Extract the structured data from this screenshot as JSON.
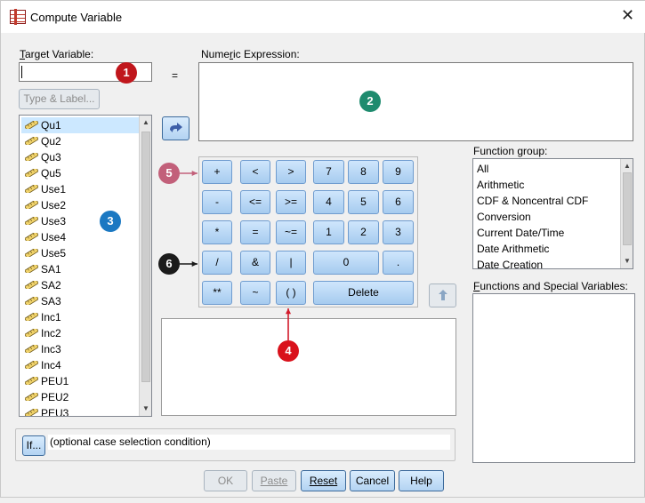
{
  "window": {
    "title": "Compute Variable",
    "close_glyph": "✕"
  },
  "target_variable": {
    "label_prefix": "",
    "label_underline": "T",
    "label_rest": "arget Variable:",
    "value": ""
  },
  "equals_sign": "=",
  "numeric_expression": {
    "label_pre": "Nume",
    "label_underline": "r",
    "label_post": "ic Expression:",
    "value": ""
  },
  "type_label_button": "Type & Label...",
  "move_button_icon": "arrow-right-icon",
  "variables": [
    "Qu1",
    "Qu2",
    "Qu3",
    "Qu5",
    "Use1",
    "Use2",
    "Use3",
    "Use4",
    "Use5",
    "SA1",
    "SA2",
    "SA3",
    "Inc1",
    "Inc2",
    "Inc3",
    "Inc4",
    "PEU1",
    "PEU2",
    "PEU3"
  ],
  "keypad": {
    "operators": [
      "+",
      "<",
      ">",
      "-",
      "<=",
      ">=",
      "*",
      "=",
      "~=",
      "/",
      "&",
      "|",
      "**",
      "~",
      "( )"
    ],
    "digits": [
      "7",
      "8",
      "9",
      "4",
      "5",
      "6",
      "1",
      "2",
      "3",
      "0",
      "."
    ],
    "delete_label": "Delete"
  },
  "function_group": {
    "label": "Function group:",
    "items": [
      "All",
      "Arithmetic",
      "CDF & Noncentral CDF",
      "Conversion",
      "Current Date/Time",
      "Date Arithmetic",
      "Date Creation"
    ]
  },
  "functions_special": {
    "label_underline": "F",
    "label_rest": "unctions and Special Variables:"
  },
  "if_button": "If...",
  "if_text": "(optional case selection condition)",
  "buttons": {
    "ok": "OK",
    "paste": "Paste",
    "reset": "Reset",
    "cancel": "Cancel",
    "help": "Help"
  },
  "markers": [
    "1",
    "2",
    "3",
    "4",
    "5",
    "6"
  ],
  "colors": {
    "marker1": "#c0161c",
    "marker2": "#1e8b6e",
    "marker3": "#1b78c2",
    "marker4": "#d9111b",
    "marker5": "#c2607a",
    "marker6": "#1b1b1b",
    "arrow": "#d21a2a"
  }
}
